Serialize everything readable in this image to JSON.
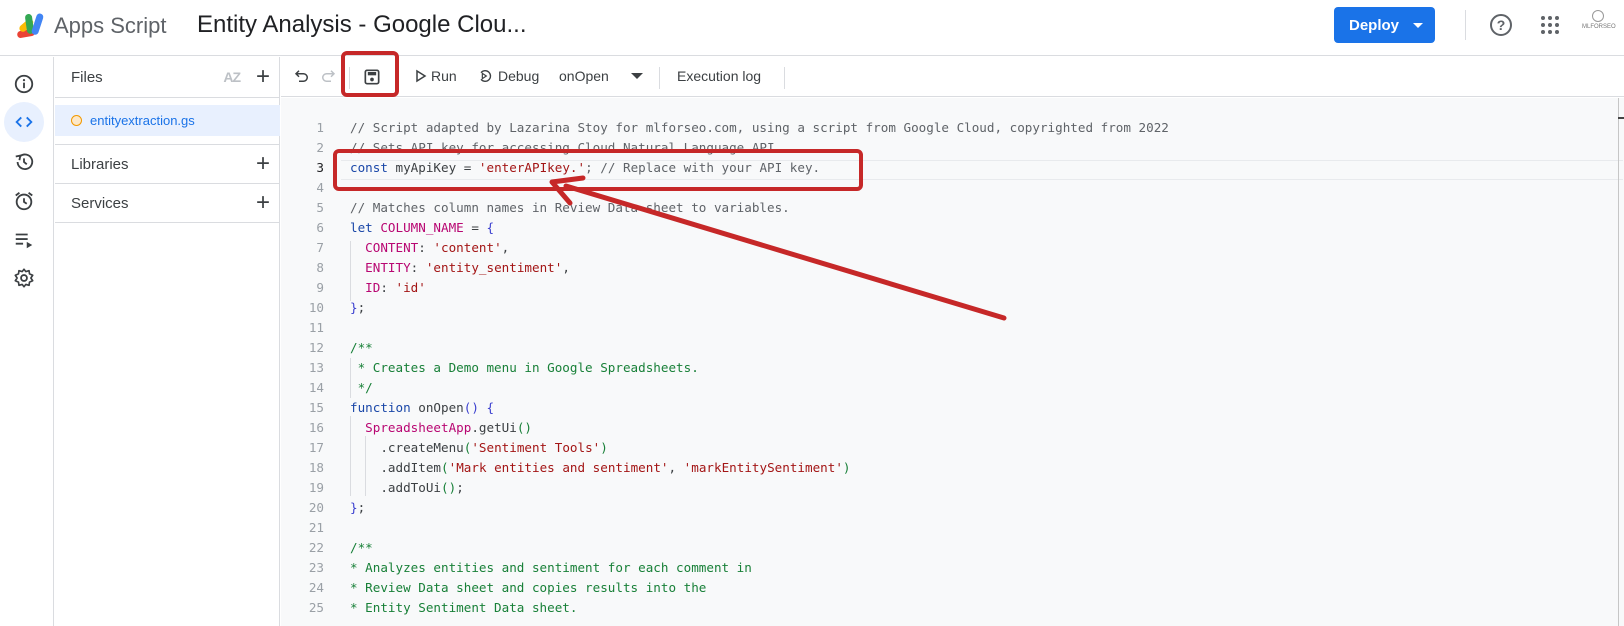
{
  "header": {
    "app_name": "Apps Script",
    "project_title": "Entity Analysis - Google Clou...",
    "deploy_label": "Deploy",
    "help_icon": "help-circle-icon",
    "apps_icon": "apps-grid-icon",
    "avatar_label": "MLFORSEO"
  },
  "rail": {
    "items": [
      {
        "name": "overview",
        "icon": "info-icon"
      },
      {
        "name": "editor",
        "icon": "code-icon",
        "active": true
      },
      {
        "name": "project-history",
        "icon": "history-icon"
      },
      {
        "name": "triggers",
        "icon": "alarm-icon"
      },
      {
        "name": "executions",
        "icon": "playlist-play-icon"
      },
      {
        "name": "project-settings",
        "icon": "gear-icon"
      }
    ]
  },
  "files_panel": {
    "files_label": "Files",
    "sort_label": "AZ",
    "files": [
      {
        "name": "entityextraction.gs",
        "status": "unsaved"
      }
    ],
    "libraries_label": "Libraries",
    "services_label": "Services"
  },
  "toolbar": {
    "undo_icon": "undo-icon",
    "redo_icon": "redo-icon",
    "save_icon": "save-icon",
    "run_label": "Run",
    "debug_label": "Debug",
    "function_selected": "onOpen",
    "execution_log_label": "Execution log"
  },
  "editor": {
    "current_line": 3,
    "lines": [
      {
        "n": "1",
        "text": "// Script adapted by Lazarina Stoy for mlforseo.com, using a script from Google Cloud, copyrighted from 2022"
      },
      {
        "n": "2",
        "text": "// Sets API key for accessing Cloud Natural Language API."
      },
      {
        "n": "3",
        "text": "const myApiKey = 'enterAPIkey.'; // Replace with your API key."
      },
      {
        "n": "4",
        "text": ""
      },
      {
        "n": "5",
        "text": "// Matches column names in Review Data sheet to variables."
      },
      {
        "n": "6",
        "text": "let COLUMN_NAME = {"
      },
      {
        "n": "7",
        "text": "  CONTENT: 'content',"
      },
      {
        "n": "8",
        "text": "  ENTITY: 'entity_sentiment',"
      },
      {
        "n": "9",
        "text": "  ID: 'id'"
      },
      {
        "n": "10",
        "text": "};"
      },
      {
        "n": "11",
        "text": ""
      },
      {
        "n": "12",
        "text": "/**"
      },
      {
        "n": "13",
        "text": " * Creates a Demo menu in Google Spreadsheets."
      },
      {
        "n": "14",
        "text": " */"
      },
      {
        "n": "15",
        "text": "function onOpen() {"
      },
      {
        "n": "16",
        "text": "  SpreadsheetApp.getUi()"
      },
      {
        "n": "17",
        "text": "    .createMenu('Sentiment Tools')"
      },
      {
        "n": "18",
        "text": "    .addItem('Mark entities and sentiment', 'markEntitySentiment')"
      },
      {
        "n": "19",
        "text": "    .addToUi();"
      },
      {
        "n": "20",
        "text": "};"
      },
      {
        "n": "21",
        "text": ""
      },
      {
        "n": "22",
        "text": "/**"
      },
      {
        "n": "23",
        "text": "* Analyzes entities and sentiment for each comment in"
      },
      {
        "n": "24",
        "text": "* Review Data sheet and copies results into the"
      },
      {
        "n": "25",
        "text": "* Entity Sentiment Data sheet."
      }
    ],
    "tokens": {
      "l3_kw": "const",
      "l3_var": " myApiKey = ",
      "l3_str": "'enterAPIkey.'",
      "l3_rest": "; // Replace with your API key.",
      "l6_kw": "let",
      "l6_name": "COLUMN_NAME",
      "l6_rest": " = ",
      "l7_key": "CONTENT",
      "l7_str": "'content'",
      "l8_key": "ENTITY",
      "l8_str": "'entity_sentiment'",
      "l9_key": "ID",
      "l9_str": "'id'",
      "l15_kw": "function",
      "l15_name": " onOpen",
      "l16_obj": "SpreadsheetApp",
      "l16_rest": ".getUi",
      "l17_m": ".createMenu",
      "l17_str": "'Sentiment Tools'",
      "l18_m": ".addItem",
      "l18_s1": "'Mark entities and sentiment'",
      "l18_s2": "'markEntitySentiment'",
      "l19_m": ".addToUi"
    }
  },
  "annotations": {
    "color": "#c62828",
    "highlighted": [
      "save-button",
      "api-key-line"
    ]
  },
  "colors": {
    "accent": "#1a73e8",
    "annotation": "#c62828",
    "selected_file_bg": "#e8f0fe",
    "editor_bg": "#f8f9fa"
  }
}
